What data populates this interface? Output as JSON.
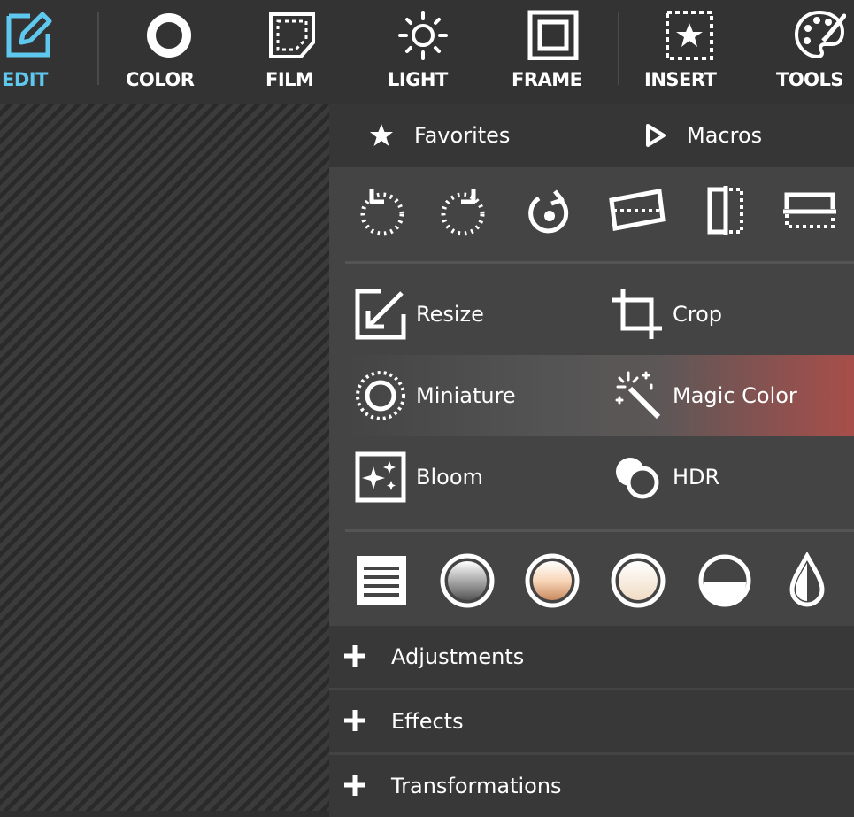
{
  "toolbar": {
    "items": [
      {
        "label": "EDIT",
        "icon": "edit-icon",
        "active": true
      },
      {
        "label": "COLOR",
        "icon": "color-ring-icon"
      },
      {
        "label": "FILM",
        "icon": "film-icon"
      },
      {
        "label": "LIGHT",
        "icon": "sun-icon"
      },
      {
        "label": "FRAME",
        "icon": "frame-icon"
      },
      {
        "label": "INSERT",
        "icon": "insert-star-icon"
      },
      {
        "label": "TOOLS",
        "icon": "palette-icon"
      }
    ],
    "active_color": "#5ec8ee"
  },
  "tabs": {
    "favorites": "Favorites",
    "macros": "Macros"
  },
  "quick_icons": [
    "rotate-left-icon",
    "rotate-right-icon",
    "rotate-auto-icon",
    "straighten-icon",
    "flip-horizontal-icon",
    "flip-vertical-icon"
  ],
  "tools": {
    "resize": "Resize",
    "crop": "Crop",
    "miniature": "Miniature",
    "magic_color": "Magic Color",
    "bloom": "Bloom",
    "hdr": "HDR"
  },
  "preset_icons": [
    "levels-icon",
    "gradient-gray-icon",
    "gradient-warm-icon",
    "gradient-light-icon",
    "half-circle-icon",
    "drop-icon"
  ],
  "sections": {
    "adjustments": "Adjustments",
    "effects": "Effects",
    "transformations": "Transformations"
  },
  "colors": {
    "highlight_accent": "#a84e4a"
  }
}
